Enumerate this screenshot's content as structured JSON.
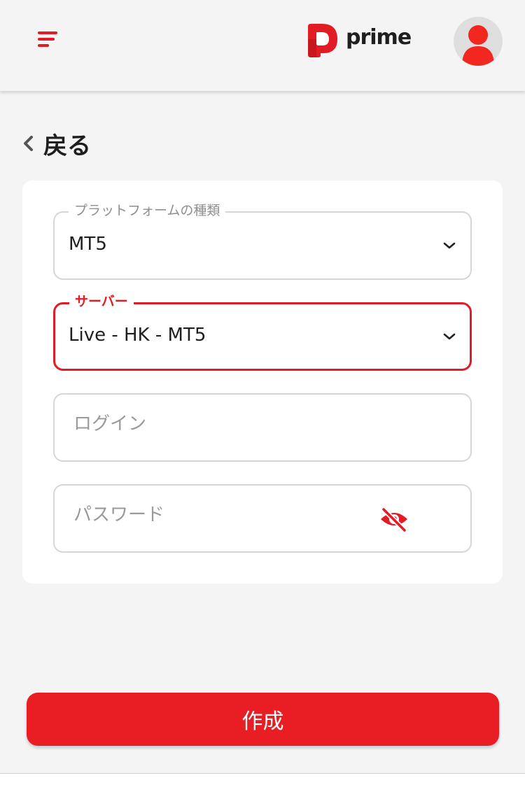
{
  "header": {
    "brand": "prime",
    "brand_color": "#e21c24",
    "menu_icon": "hamburger-menu-icon",
    "avatar_icon": "user-avatar-icon"
  },
  "nav": {
    "back_label": "戻る",
    "back_icon": "chevron-left-icon"
  },
  "form": {
    "platform": {
      "label": "プラットフォームの種類",
      "value": "MT5"
    },
    "server": {
      "label": "サーバー",
      "value": "Live - HK - MT5"
    },
    "login": {
      "placeholder": "ログイン",
      "value": ""
    },
    "password": {
      "placeholder": "パスワード",
      "value": "",
      "toggle_icon": "eye-slash-icon"
    }
  },
  "actions": {
    "submit_label": "作成"
  },
  "colors": {
    "accent": "#e21c24",
    "button": "#e91e25",
    "background": "#f4f4f4"
  }
}
